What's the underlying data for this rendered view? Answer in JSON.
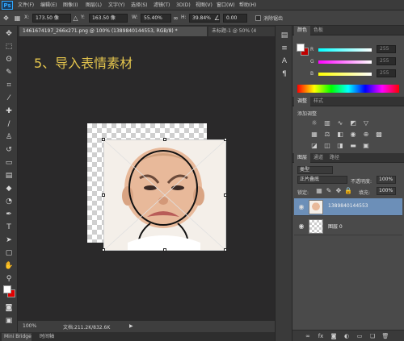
{
  "app": {
    "logo": "Ps"
  },
  "menu": [
    "文件(F)",
    "编辑(E)",
    "图像(I)",
    "图层(L)",
    "文字(Y)",
    "选择(S)",
    "滤镜(T)",
    "3D(D)",
    "视图(V)",
    "窗口(W)",
    "帮助(H)"
  ],
  "options": {
    "x_label": "X:",
    "x_value": "173.50 像",
    "y_label": "Y:",
    "y_value": "163.50 像",
    "w_label": "W:",
    "w_value": "55.40%",
    "h_label": "H:",
    "h_value": "39.84%",
    "angle_value": "0.00",
    "hv_label": "H:",
    "hv_value": "0.00",
    "v_label": "V:",
    "v_value": "0.00",
    "interp_label": "两次立方",
    "tail": "样",
    "commit_text": "消除锯齿"
  },
  "tabs": [
    {
      "label": "1461674197_266x271.png @ 100% (1389840144553, RGB/8) *",
      "active": true
    },
    {
      "label": "未标题-1 @ 50% (4",
      "active": false
    }
  ],
  "canvas": {
    "title": "5、导入表情素材"
  },
  "status": {
    "zoom": "100%",
    "doc": "文档:211.2K/832.6K"
  },
  "bottom_tabs": [
    "Mini Bridge",
    "时间轴"
  ],
  "color_panel": {
    "tabs": [
      "颜色",
      "色板"
    ],
    "sliders": [
      {
        "letter": "R",
        "value": "255"
      },
      {
        "letter": "G",
        "value": "255"
      },
      {
        "letter": "B",
        "value": "255"
      }
    ]
  },
  "adjust_panel": {
    "tabs": [
      "调整",
      "样式"
    ],
    "add_label": "添加调整"
  },
  "layers_panel": {
    "tabs": [
      "图层",
      "通道",
      "路径"
    ],
    "kind": "类型",
    "blend_mode": "正片叠底",
    "opacity_label": "不透明度:",
    "opacity_value": "100%",
    "lock_label": "锁定:",
    "fill_label": "填充:",
    "fill_value": "100%",
    "layers": [
      {
        "name": "1389840144553",
        "selected": true
      },
      {
        "name": "图层 0",
        "selected": false
      }
    ]
  },
  "colors": {
    "fg": "#ffffff",
    "bg": "#e00000",
    "accent_text": "#e3c44d"
  }
}
